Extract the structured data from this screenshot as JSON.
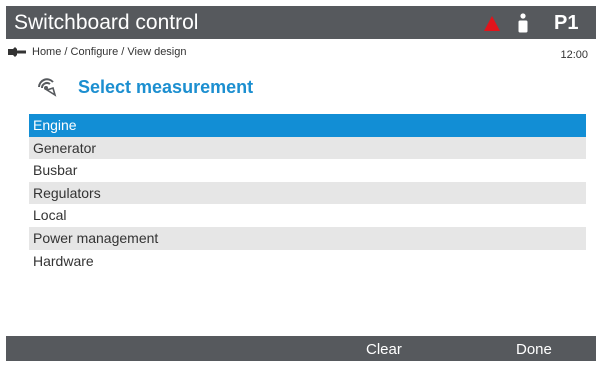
{
  "header": {
    "title": "Switchboard control",
    "page_id": "P1",
    "alarm_icon": "warning-triangle-icon",
    "user_icon": "operator-icon",
    "alarm_color": "#e1141b"
  },
  "breadcrumb": {
    "icon": "wrench-icon",
    "path": "Home / Configure / View design",
    "time": "12:00"
  },
  "main": {
    "icon": "measurement-gauge-icon",
    "title": "Select measurement",
    "title_color": "#1c8fd0",
    "items": [
      {
        "label": "Engine",
        "selected": true
      },
      {
        "label": "Generator"
      },
      {
        "label": "Busbar"
      },
      {
        "label": "Regulators"
      },
      {
        "label": "Local"
      },
      {
        "label": "Power management"
      },
      {
        "label": "Hardware"
      }
    ],
    "selection_color": "#128ed5"
  },
  "footer": {
    "clear_label": "Clear",
    "done_label": "Done"
  }
}
